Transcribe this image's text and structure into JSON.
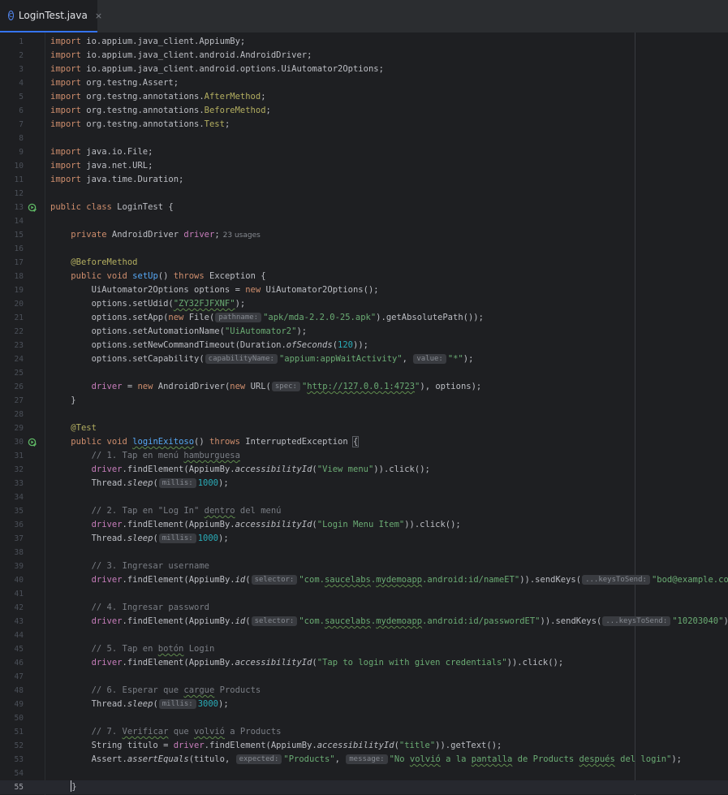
{
  "tab": {
    "icon": "java-class-icon",
    "label": "LoginTest.java",
    "close": "×"
  },
  "lines": [
    {
      "ln": "1",
      "t": [
        {
          "v": "import",
          "c": "k"
        },
        {
          "v": " io.appium.java_client.AppiumBy;"
        }
      ]
    },
    {
      "ln": "2",
      "t": [
        {
          "v": "import",
          "c": "k"
        },
        {
          "v": " io.appium.java_client.android.AndroidDriver;"
        }
      ]
    },
    {
      "ln": "3",
      "t": [
        {
          "v": "import",
          "c": "k"
        },
        {
          "v": " io.appium.java_client.android.options.UiAutomator2Options;"
        }
      ]
    },
    {
      "ln": "4",
      "t": [
        {
          "v": "import",
          "c": "k"
        },
        {
          "v": " org.testng.Assert;"
        }
      ]
    },
    {
      "ln": "5",
      "t": [
        {
          "v": "import",
          "c": "k"
        },
        {
          "v": " org.testng.annotations."
        },
        {
          "v": "AfterMethod",
          "c": "a"
        },
        {
          "v": ";"
        }
      ]
    },
    {
      "ln": "6",
      "t": [
        {
          "v": "import",
          "c": "k"
        },
        {
          "v": " org.testng.annotations."
        },
        {
          "v": "BeforeMethod",
          "c": "a"
        },
        {
          "v": ";"
        }
      ]
    },
    {
      "ln": "7",
      "t": [
        {
          "v": "import",
          "c": "k"
        },
        {
          "v": " org.testng.annotations."
        },
        {
          "v": "Test",
          "c": "a"
        },
        {
          "v": ";"
        }
      ]
    },
    {
      "ln": "8",
      "t": []
    },
    {
      "ln": "9",
      "t": [
        {
          "v": "import",
          "c": "k"
        },
        {
          "v": " java.io.File;"
        }
      ]
    },
    {
      "ln": "10",
      "t": [
        {
          "v": "import",
          "c": "k"
        },
        {
          "v": " java.net.URL;"
        }
      ]
    },
    {
      "ln": "11",
      "t": [
        {
          "v": "import",
          "c": "k"
        },
        {
          "v": " java.time.Duration;"
        }
      ]
    },
    {
      "ln": "12",
      "t": []
    },
    {
      "ln": "13",
      "gutter": "run-test-icon",
      "t": [
        {
          "v": "public class",
          "c": "k"
        },
        {
          "v": " LoginTest {"
        }
      ]
    },
    {
      "ln": "14",
      "t": []
    },
    {
      "ln": "15",
      "t": [
        {
          "v": "    "
        },
        {
          "v": "private",
          "c": "k"
        },
        {
          "v": " AndroidDriver "
        },
        {
          "v": "driver",
          "c": "f"
        },
        {
          "v": ";"
        },
        {
          "v": "23 usages",
          "c": "usages"
        }
      ]
    },
    {
      "ln": "16",
      "t": []
    },
    {
      "ln": "17",
      "t": [
        {
          "v": "    "
        },
        {
          "v": "@BeforeMethod",
          "c": "a"
        }
      ]
    },
    {
      "ln": "18",
      "t": [
        {
          "v": "    "
        },
        {
          "v": "public void",
          "c": "k"
        },
        {
          "v": " "
        },
        {
          "v": "setUp",
          "c": "m"
        },
        {
          "v": "() "
        },
        {
          "v": "throws",
          "c": "k"
        },
        {
          "v": " Exception {"
        }
      ]
    },
    {
      "ln": "19",
      "t": [
        {
          "v": "        UiAutomator2Options options = "
        },
        {
          "v": "new",
          "c": "k"
        },
        {
          "v": " UiAutomator2Options();"
        }
      ]
    },
    {
      "ln": "20",
      "t": [
        {
          "v": "        options.setUdid("
        },
        {
          "v": "\"ZY32FJFXNF\"",
          "c": "s typo"
        },
        {
          "v": ");"
        }
      ]
    },
    {
      "ln": "21",
      "t": [
        {
          "v": "        options.setApp("
        },
        {
          "v": "new",
          "c": "k"
        },
        {
          "v": " File("
        },
        {
          "v": "pathname:",
          "c": "hint"
        },
        {
          "v": "\"apk/mda-2.2.0-25.apk\"",
          "c": "s"
        },
        {
          "v": ").getAbsolutePath());"
        }
      ]
    },
    {
      "ln": "22",
      "t": [
        {
          "v": "        options.setAutomationName("
        },
        {
          "v": "\"UiAutomator2\"",
          "c": "s"
        },
        {
          "v": ");"
        }
      ]
    },
    {
      "ln": "23",
      "t": [
        {
          "v": "        options.setNewCommandTimeout(Duration."
        },
        {
          "v": "ofSeconds",
          "c": "i"
        },
        {
          "v": "("
        },
        {
          "v": "120",
          "c": "n"
        },
        {
          "v": "));"
        }
      ]
    },
    {
      "ln": "24",
      "t": [
        {
          "v": "        options.setCapability("
        },
        {
          "v": "capabilityName:",
          "c": "hint"
        },
        {
          "v": "\"appium:appWaitActivity\"",
          "c": "s"
        },
        {
          "v": ", "
        },
        {
          "v": "value:",
          "c": "hint"
        },
        {
          "v": "\"*\"",
          "c": "s"
        },
        {
          "v": ");"
        }
      ]
    },
    {
      "ln": "25",
      "t": []
    },
    {
      "ln": "26",
      "t": [
        {
          "v": "        "
        },
        {
          "v": "driver",
          "c": "f"
        },
        {
          "v": " = "
        },
        {
          "v": "new",
          "c": "k"
        },
        {
          "v": " AndroidDriver("
        },
        {
          "v": "new",
          "c": "k"
        },
        {
          "v": " URL("
        },
        {
          "v": "spec:",
          "c": "hint"
        },
        {
          "v": "\"",
          "c": "s"
        },
        {
          "v": "http://127.0.0.1:4723",
          "c": "s typo"
        },
        {
          "v": "\"",
          "c": "s"
        },
        {
          "v": "), options);"
        }
      ]
    },
    {
      "ln": "27",
      "t": [
        {
          "v": "    }"
        }
      ]
    },
    {
      "ln": "28",
      "t": []
    },
    {
      "ln": "29",
      "t": [
        {
          "v": "    "
        },
        {
          "v": "@Test",
          "c": "a"
        }
      ]
    },
    {
      "ln": "30",
      "gutter": "run-test-icon",
      "t": [
        {
          "v": "    "
        },
        {
          "v": "public void",
          "c": "k"
        },
        {
          "v": " "
        },
        {
          "v": "loginExitoso",
          "c": "m typo"
        },
        {
          "v": "() "
        },
        {
          "v": "throws",
          "c": "k"
        },
        {
          "v": " InterruptedException "
        },
        {
          "v": "{",
          "c": "brace-hl"
        }
      ]
    },
    {
      "ln": "31",
      "t": [
        {
          "v": "        // 1. Tap en menú ",
          "c": "c"
        },
        {
          "v": "hamburguesa",
          "c": "c typo"
        }
      ]
    },
    {
      "ln": "32",
      "t": [
        {
          "v": "        "
        },
        {
          "v": "driver",
          "c": "f"
        },
        {
          "v": ".findElement(AppiumBy."
        },
        {
          "v": "accessibilityId",
          "c": "i"
        },
        {
          "v": "("
        },
        {
          "v": "\"View menu\"",
          "c": "s"
        },
        {
          "v": ")).click();"
        }
      ]
    },
    {
      "ln": "33",
      "t": [
        {
          "v": "        Thread."
        },
        {
          "v": "sleep",
          "c": "i"
        },
        {
          "v": "("
        },
        {
          "v": "millis:",
          "c": "hint"
        },
        {
          "v": "1000",
          "c": "n"
        },
        {
          "v": ");"
        }
      ]
    },
    {
      "ln": "34",
      "t": []
    },
    {
      "ln": "35",
      "t": [
        {
          "v": "        // 2. Tap en \"Log In\" ",
          "c": "c"
        },
        {
          "v": "dentro",
          "c": "c typo"
        },
        {
          "v": " del menú",
          "c": "c"
        }
      ]
    },
    {
      "ln": "36",
      "t": [
        {
          "v": "        "
        },
        {
          "v": "driver",
          "c": "f"
        },
        {
          "v": ".findElement(AppiumBy."
        },
        {
          "v": "accessibilityId",
          "c": "i"
        },
        {
          "v": "("
        },
        {
          "v": "\"Login Menu Item\"",
          "c": "s"
        },
        {
          "v": ")).click();"
        }
      ]
    },
    {
      "ln": "37",
      "t": [
        {
          "v": "        Thread."
        },
        {
          "v": "sleep",
          "c": "i"
        },
        {
          "v": "("
        },
        {
          "v": "millis:",
          "c": "hint"
        },
        {
          "v": "1000",
          "c": "n"
        },
        {
          "v": ");"
        }
      ]
    },
    {
      "ln": "38",
      "t": []
    },
    {
      "ln": "39",
      "t": [
        {
          "v": "        // 3. Ingresar username",
          "c": "c"
        }
      ]
    },
    {
      "ln": "40",
      "t": [
        {
          "v": "        "
        },
        {
          "v": "driver",
          "c": "f"
        },
        {
          "v": ".findElement(AppiumBy."
        },
        {
          "v": "id",
          "c": "i"
        },
        {
          "v": "("
        },
        {
          "v": "selector:",
          "c": "hint"
        },
        {
          "v": "\"com.",
          "c": "s"
        },
        {
          "v": "saucelabs",
          "c": "s typo"
        },
        {
          "v": ".",
          "c": "s"
        },
        {
          "v": "mydemoapp",
          "c": "s typo"
        },
        {
          "v": ".android:id/nameET\"",
          "c": "s"
        },
        {
          "v": ")).sendKeys("
        },
        {
          "v": "...keysToSend:",
          "c": "hint"
        },
        {
          "v": "\"bod@example.com\"",
          "c": "s"
        },
        {
          "v": ");"
        }
      ]
    },
    {
      "ln": "41",
      "t": []
    },
    {
      "ln": "42",
      "t": [
        {
          "v": "        // 4. Ingresar password",
          "c": "c"
        }
      ]
    },
    {
      "ln": "43",
      "t": [
        {
          "v": "        "
        },
        {
          "v": "driver",
          "c": "f"
        },
        {
          "v": ".findElement(AppiumBy."
        },
        {
          "v": "id",
          "c": "i"
        },
        {
          "v": "("
        },
        {
          "v": "selector:",
          "c": "hint"
        },
        {
          "v": "\"com.",
          "c": "s"
        },
        {
          "v": "saucelabs",
          "c": "s typo"
        },
        {
          "v": ".",
          "c": "s"
        },
        {
          "v": "mydemoapp",
          "c": "s typo"
        },
        {
          "v": ".android:id/passwordET\"",
          "c": "s"
        },
        {
          "v": ")).sendKeys("
        },
        {
          "v": "...keysToSend:",
          "c": "hint"
        },
        {
          "v": "\"10203040\"",
          "c": "s"
        },
        {
          "v": ");"
        }
      ]
    },
    {
      "ln": "44",
      "t": []
    },
    {
      "ln": "45",
      "t": [
        {
          "v": "        // 5. Tap en ",
          "c": "c"
        },
        {
          "v": "botón",
          "c": "c typo"
        },
        {
          "v": " Login",
          "c": "c"
        }
      ]
    },
    {
      "ln": "46",
      "t": [
        {
          "v": "        "
        },
        {
          "v": "driver",
          "c": "f"
        },
        {
          "v": ".findElement(AppiumBy."
        },
        {
          "v": "accessibilityId",
          "c": "i"
        },
        {
          "v": "("
        },
        {
          "v": "\"Tap to login with given credentials\"",
          "c": "s"
        },
        {
          "v": ")).click();"
        }
      ]
    },
    {
      "ln": "47",
      "t": []
    },
    {
      "ln": "48",
      "t": [
        {
          "v": "        // 6. Esperar que ",
          "c": "c"
        },
        {
          "v": "cargue",
          "c": "c typo"
        },
        {
          "v": " Products",
          "c": "c"
        }
      ]
    },
    {
      "ln": "49",
      "t": [
        {
          "v": "        Thread."
        },
        {
          "v": "sleep",
          "c": "i"
        },
        {
          "v": "("
        },
        {
          "v": "millis:",
          "c": "hint"
        },
        {
          "v": "3000",
          "c": "n"
        },
        {
          "v": ");"
        }
      ]
    },
    {
      "ln": "50",
      "t": []
    },
    {
      "ln": "51",
      "t": [
        {
          "v": "        // 7. ",
          "c": "c"
        },
        {
          "v": "Verificar",
          "c": "c typo"
        },
        {
          "v": " que ",
          "c": "c"
        },
        {
          "v": "volvió",
          "c": "c typo"
        },
        {
          "v": " a Products",
          "c": "c"
        }
      ]
    },
    {
      "ln": "52",
      "t": [
        {
          "v": "        String titulo = "
        },
        {
          "v": "driver",
          "c": "f"
        },
        {
          "v": ".findElement(AppiumBy."
        },
        {
          "v": "accessibilityId",
          "c": "i"
        },
        {
          "v": "("
        },
        {
          "v": "\"title\"",
          "c": "s"
        },
        {
          "v": ")).getText();"
        }
      ]
    },
    {
      "ln": "53",
      "t": [
        {
          "v": "        Assert."
        },
        {
          "v": "assertEquals",
          "c": "i"
        },
        {
          "v": "(titulo, "
        },
        {
          "v": "expected:",
          "c": "hint"
        },
        {
          "v": "\"Products\"",
          "c": "s"
        },
        {
          "v": ", "
        },
        {
          "v": "message:",
          "c": "hint"
        },
        {
          "v": "\"No ",
          "c": "s"
        },
        {
          "v": "volvió",
          "c": "s typo"
        },
        {
          "v": " a la ",
          "c": "s"
        },
        {
          "v": "pantalla",
          "c": "s typo"
        },
        {
          "v": " de Products ",
          "c": "s"
        },
        {
          "v": "después",
          "c": "s typo"
        },
        {
          "v": " del login\"",
          "c": "s"
        },
        {
          "v": ");"
        }
      ]
    },
    {
      "ln": "54",
      "t": []
    },
    {
      "ln": "55",
      "current": true,
      "t": [
        {
          "v": "    "
        },
        {
          "v": "caret",
          "c": "caret"
        },
        {
          "v": "}"
        }
      ]
    }
  ]
}
